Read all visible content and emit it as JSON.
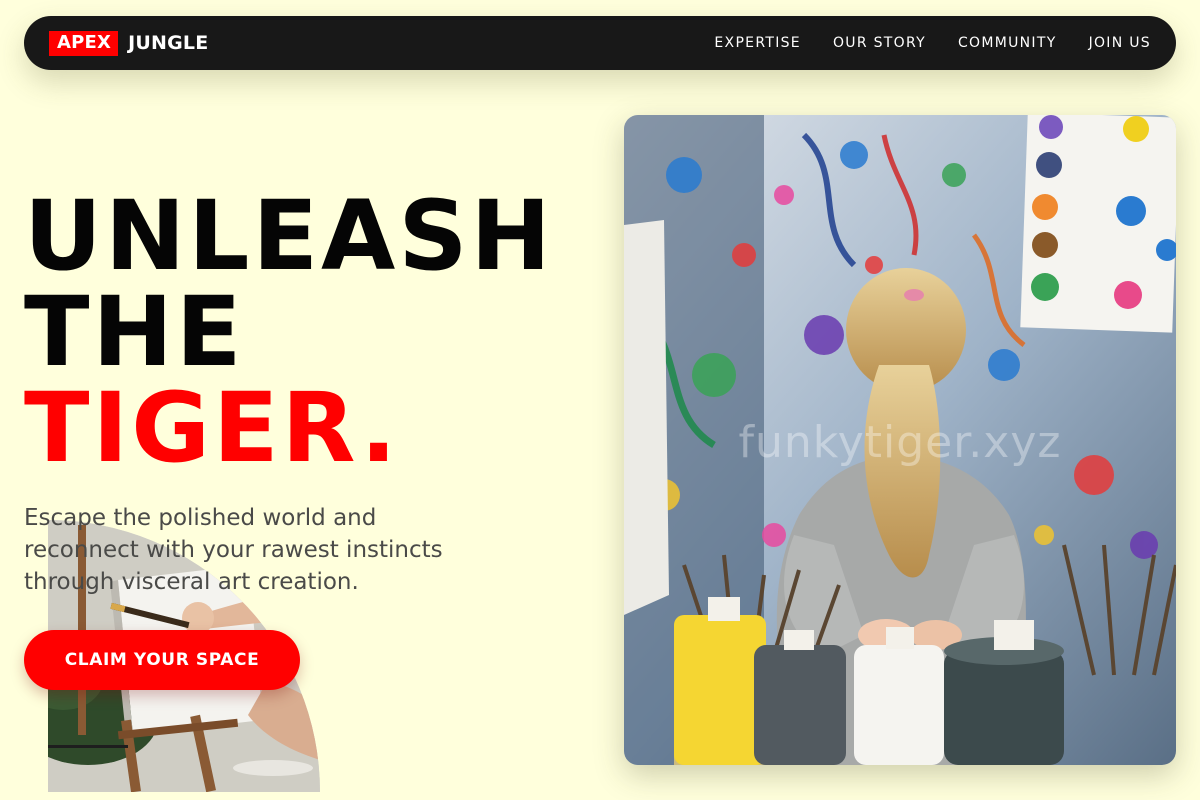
{
  "nav": {
    "logo_brand": "APEX",
    "logo_name": "JUNGLE",
    "links": [
      {
        "label": "EXPERTISE"
      },
      {
        "label": "OUR STORY"
      },
      {
        "label": "COMMUNITY"
      },
      {
        "label": "JOIN US"
      }
    ]
  },
  "hero": {
    "headline_line1": "UNLEASH",
    "headline_line2": "THE",
    "headline_line3": "TIGER.",
    "subtext": "Escape the polished world and reconnect with your rawest instincts through visceral art creation.",
    "cta_label": "CLAIM YOUR SPACE",
    "image_watermark": "funkytiger.xyz"
  },
  "colors": {
    "background": "#ffffdc",
    "navbar": "#181818",
    "accent": "#ff0000",
    "headline": "#050505",
    "body_text": "#4a4a48"
  },
  "icons": {
    "small_image": "painter-easel-photo",
    "main_image": "girl-in-paint-studio-photo"
  }
}
